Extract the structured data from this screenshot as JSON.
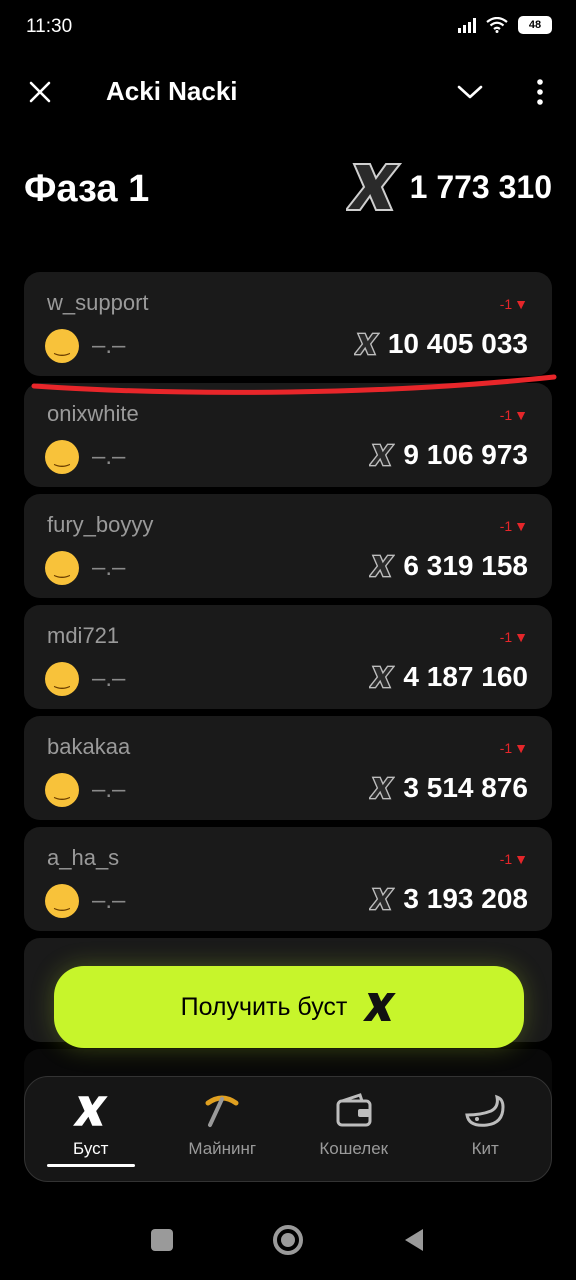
{
  "status": {
    "time": "11:30",
    "battery": "48"
  },
  "app_bar": {
    "title": "Acki Nacki"
  },
  "phase": {
    "title": "Фаза 1",
    "total": "1 773 310"
  },
  "leaderboard": [
    {
      "username": "w_support",
      "delta": "-1",
      "trend": "down",
      "rank_text": "–.–",
      "score": "10 405 033"
    },
    {
      "username": "onixwhite",
      "delta": "-1",
      "trend": "down",
      "rank_text": "–.–",
      "score": "9 106 973"
    },
    {
      "username": "fury_boyyy",
      "delta": "-1",
      "trend": "down",
      "rank_text": "–.–",
      "score": "6 319 158"
    },
    {
      "username": "mdi721",
      "delta": "-1",
      "trend": "down",
      "rank_text": "–.–",
      "score": "4 187 160"
    },
    {
      "username": "bakakaa",
      "delta": "-1",
      "trend": "down",
      "rank_text": "–.–",
      "score": "3 514 876"
    },
    {
      "username": "a_ha_s",
      "delta": "-1",
      "trend": "down",
      "rank_text": "–.–",
      "score": "3 193 208"
    }
  ],
  "boost_button": {
    "label": "Получить буст"
  },
  "nav": {
    "items": [
      {
        "label": "Буст",
        "icon": "boost-x-icon",
        "active": true
      },
      {
        "label": "Майнинг",
        "icon": "pickaxe-icon",
        "active": false
      },
      {
        "label": "Кошелек",
        "icon": "wallet-icon",
        "active": false
      },
      {
        "label": "Кит",
        "icon": "whale-icon",
        "active": false
      }
    ]
  },
  "colors": {
    "accent": "#c7f52b",
    "negative": "#e5262a",
    "card": "#1a1a1a",
    "background": "#000000"
  }
}
